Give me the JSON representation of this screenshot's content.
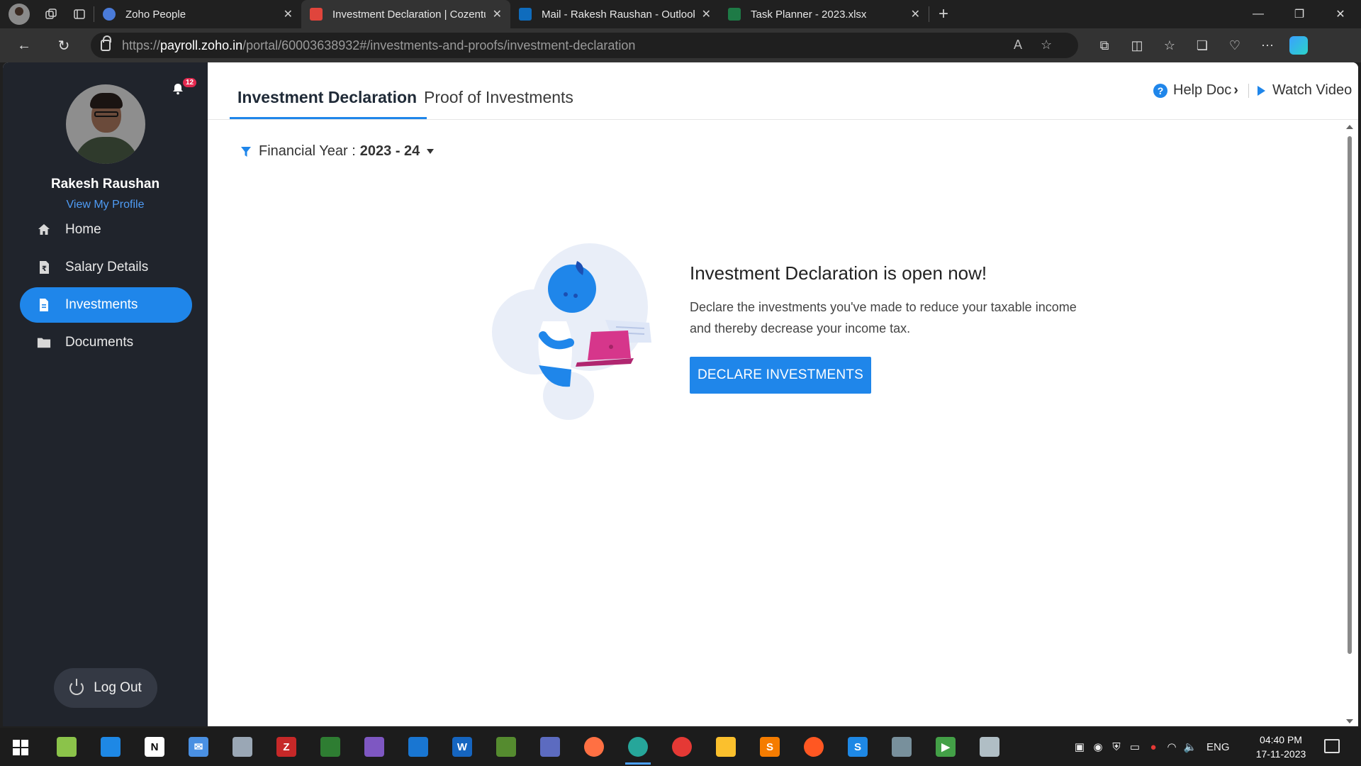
{
  "browser": {
    "tabs": [
      {
        "title": "Zoho People",
        "color": "#4a7bd9",
        "active": false
      },
      {
        "title": "Investment Declaration | Cozentu",
        "color": "#e0453c",
        "active": true
      },
      {
        "title": "Mail - Rakesh Raushan - Outlook",
        "color": "#0f6cbd",
        "active": false
      },
      {
        "title": "Task Planner - 2023.xlsx",
        "color": "#1e7a46",
        "active": false
      }
    ],
    "url_prefix": "https://",
    "url_host": "payroll.zoho.in",
    "url_path": "/portal/60003638932#/investments-and-proofs/investment-declaration"
  },
  "sidebar": {
    "user_name": "Rakesh Raushan",
    "view_profile": "View My Profile",
    "notification_count": "12",
    "items": [
      {
        "label": "Home",
        "icon": "home-icon",
        "active": false
      },
      {
        "label": "Salary Details",
        "icon": "salary-doc-icon",
        "active": false
      },
      {
        "label": "Investments",
        "icon": "document-icon",
        "active": true
      },
      {
        "label": "Documents",
        "icon": "folder-icon",
        "active": false
      }
    ],
    "logout": "Log Out"
  },
  "main": {
    "tabs": [
      {
        "label": "Investment Declaration",
        "active": true
      },
      {
        "label": "Proof of Investments",
        "active": false
      }
    ],
    "help_doc": "Help Doc",
    "watch_video": "Watch Video",
    "financial_year_label": "Financial Year :",
    "financial_year_value": "2023 - 24",
    "declaration": {
      "title": "Investment Declaration is open now!",
      "description": "Declare the investments you've made to reduce your taxable income and thereby decrease your income tax.",
      "button": "DECLARE INVESTMENTS"
    }
  },
  "taskbar": {
    "language": "ENG",
    "time": "04:40 PM",
    "date": "17-11-2023"
  },
  "colors": {
    "accent": "#1f86ea",
    "sidebar_bg": "#20242c",
    "badge": "#e2294f"
  }
}
